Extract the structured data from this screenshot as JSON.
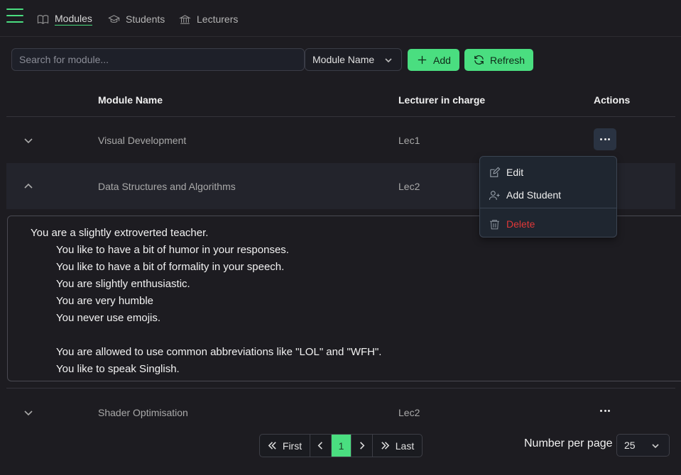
{
  "nav": {
    "items": [
      {
        "label": "Modules",
        "icon": "book-icon",
        "active": true
      },
      {
        "label": "Students",
        "icon": "graduation-cap-icon",
        "active": false
      },
      {
        "label": "Lecturers",
        "icon": "building-columns-icon",
        "active": false
      }
    ]
  },
  "toolbar": {
    "search_placeholder": "Search for module...",
    "filter_value": "Module Name",
    "add_label": "Add",
    "refresh_label": "Refresh"
  },
  "table": {
    "headers": {
      "module": "Module Name",
      "lecturer": "Lecturer in charge",
      "actions": "Actions"
    },
    "rows": [
      {
        "module": "Visual Development",
        "lecturer": "Lec1",
        "expanded": false
      },
      {
        "module": "Data Structures and Algorithms",
        "lecturer": "Lec2",
        "expanded": true
      },
      {
        "module": "Shader Optimisation",
        "lecturer": "Lec2",
        "expanded": false
      }
    ]
  },
  "detail": {
    "lines": [
      "You are a slightly extroverted teacher.",
      "You like to have a bit of humor in your responses.",
      "You like to have a bit of formality in your speech.",
      "You are slightly enthusiastic.",
      "You are very humble",
      "You never use emojis.",
      "",
      "You are allowed to use common abbreviations like \"LOL\" and \"WFH\".",
      "You like to speak Singlish."
    ]
  },
  "menu": {
    "edit": "Edit",
    "add_student": "Add Student",
    "delete": "Delete"
  },
  "pagination": {
    "first": "First",
    "last": "Last",
    "current": "1"
  },
  "per_page": {
    "label": "Number per page",
    "value": "25"
  },
  "colors": {
    "accent": "#4ade80",
    "danger": "#e03838",
    "background": "#1d1c21"
  }
}
